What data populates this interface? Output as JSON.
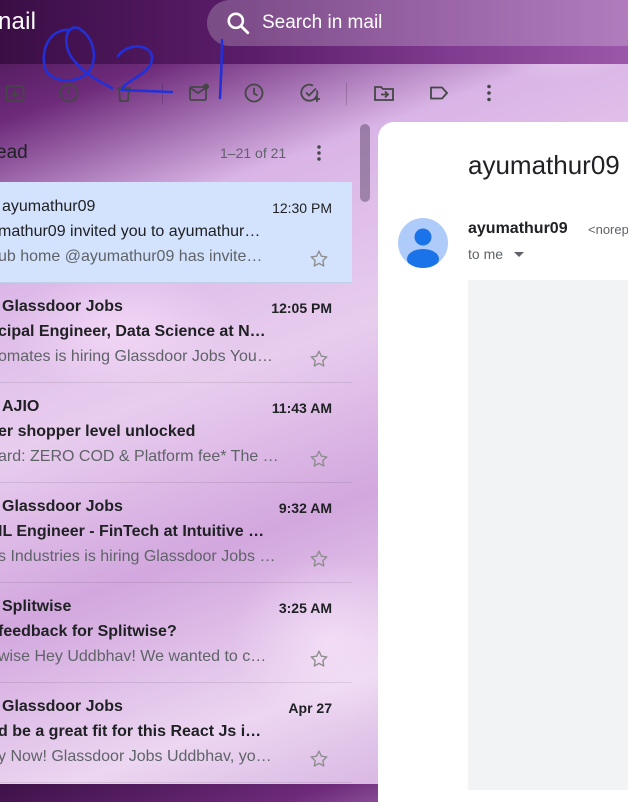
{
  "header": {
    "app_title": "nail",
    "search_placeholder": "Search in mail"
  },
  "toolbar": {
    "icons": [
      "archive-icon",
      "report-spam-icon",
      "delete-icon",
      "mark-unread-icon",
      "snooze-icon",
      "add-to-tasks-icon",
      "move-to-icon",
      "label-icon",
      "more-vert-icon"
    ]
  },
  "list": {
    "label": "ead",
    "count": "1–21 of 21",
    "rows": [
      {
        "sender": "ayumathur09",
        "time": "12:30 PM",
        "subject": "mathur09 invited you to ayumathur…",
        "snippet": "ub home @ayumathur09 has invite…",
        "unread": false,
        "selected": true
      },
      {
        "sender": "Glassdoor Jobs",
        "time": "12:05 PM",
        "subject": "cipal Engineer, Data Science at N…",
        "snippet": "omates is hiring Glassdoor Jobs You…",
        "unread": true,
        "selected": false
      },
      {
        "sender": "AJIO",
        "time": "11:43 AM",
        "subject": "er shopper level unlocked",
        "snippet": "ard: ZERO COD & Platform fee* The …",
        "unread": true,
        "selected": false
      },
      {
        "sender": "Glassdoor Jobs",
        "time": "9:32 AM",
        "subject": "IL Engineer - FinTech at Intuitive …",
        "snippet": "s Industries is hiring Glassdoor Jobs …",
        "unread": true,
        "selected": false
      },
      {
        "sender": "Splitwise",
        "time": "3:25 AM",
        "subject": "feedback for Splitwise?",
        "snippet": "wise Hey Uddbhav! We wanted to c…",
        "unread": true,
        "selected": false
      },
      {
        "sender": "Glassdoor Jobs",
        "time": "Apr 27",
        "subject": "d be a great fit for this React Js i…",
        "snippet": "y Now! Glassdoor Jobs Uddbhav, yo…",
        "unread": true,
        "selected": false
      }
    ]
  },
  "reader": {
    "subject": "ayumathur09",
    "from_name": "ayumathur09",
    "from_addr": "<norep",
    "to": "to me"
  },
  "colors": {
    "selected_row": "#d3e3fd",
    "avatar_bg": "#aecbfa",
    "avatar_fg": "#1a73e8",
    "ink": "#2130d8"
  }
}
